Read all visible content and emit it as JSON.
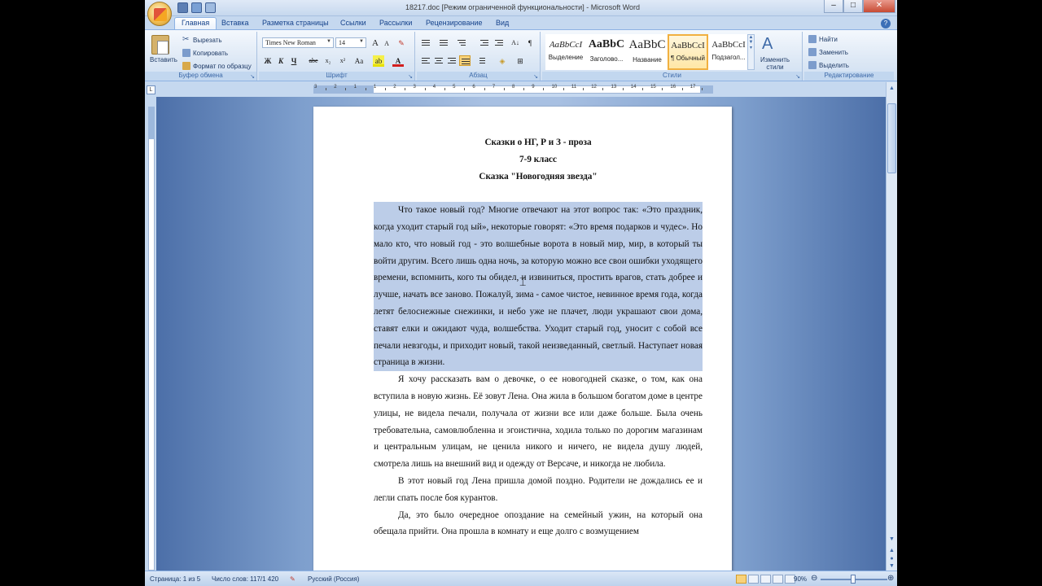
{
  "titlebar": {
    "title": "18217.doc [Режим ограниченной функциональности] - Microsoft Word",
    "controls": [
      "–",
      "□",
      "✕"
    ]
  },
  "tabs": [
    {
      "label": "Главная",
      "active": true
    },
    {
      "label": "Вставка"
    },
    {
      "label": "Разметка страницы"
    },
    {
      "label": "Ссылки"
    },
    {
      "label": "Рассылки"
    },
    {
      "label": "Рецензирование"
    },
    {
      "label": "Вид"
    }
  ],
  "ribbon": {
    "clipboard": {
      "label": "Буфер обмена",
      "paste": "Вставить",
      "cut": "Вырезать",
      "copy": "Копировать",
      "format_painter": "Формат по образцу"
    },
    "font": {
      "label": "Шрифт",
      "font_name": "Times New Roman",
      "font_size": "14",
      "bold": "Ж",
      "italic": "К",
      "underline": "Ч",
      "strike": "abe",
      "subscript": "x₂",
      "superscript": "x²",
      "change_case": "Aa",
      "grow": "A",
      "shrink": "A"
    },
    "paragraph": {
      "label": "Абзац"
    },
    "styles": {
      "label": "Стили",
      "items": [
        {
          "sample": "AaBbCcI",
          "name": "Выделение"
        },
        {
          "sample": "AaBbC",
          "name": "Заголово..."
        },
        {
          "sample": "AaBbC",
          "name": "Название"
        },
        {
          "sample": "AaBbCcI",
          "name": "¶ Обычный",
          "active": true
        },
        {
          "sample": "AaBbCcI",
          "name": "Подзагол..."
        }
      ],
      "change_styles": "Изменить стили"
    },
    "editing": {
      "label": "Редактирование",
      "find": "Найти",
      "replace": "Заменить",
      "select": "Выделить"
    }
  },
  "ruler": {
    "numbers": [
      "3",
      "2",
      "1",
      "1",
      "2",
      "3",
      "4",
      "5",
      "6",
      "7",
      "8",
      "9",
      "10",
      "11",
      "12",
      "13",
      "14",
      "15",
      "16",
      "17"
    ]
  },
  "document": {
    "headings": [
      "Сказки о НГ, Р и З - проза",
      "7-9 класс",
      "Сказка \"Новогодняя звезда\""
    ],
    "paragraphs": [
      {
        "text": "Что такое новый год? Многие отвечают на этот вопрос так: «Это праздник, когда уходит старый год ый», некоторые говорят: «Это время подарков и чудес». Но мало кто, что новый год - это волшебные ворота в новый мир, мир, в который ты войти другим. Всего лишь одна ночь, за которую можно все свои ошибки уходящего времени, вспомнить, кого ты обидел, и  извиниться, простить врагов, стать добрее и лучше, начать все заново. Пожалуй, зима -  самое чистое, невинное время года, когда летят белоснежные снежинки, и небо уже не плачет,  люди  украшают свои дома, ставят елки и ожидают чуда, волшебства. Уходит старый год, уносит с собой все печали невзгоды, и приходит новый, такой неизведанный, светлый. Наступает новая страница в жизни.",
        "selected": true
      },
      {
        "text": "Я хочу рассказать вам о девочке, о ее новогодней сказке, о том, как она вступила в новую жизнь. Её зовут Лена. Она жила в большом богатом доме в центре улицы, не видела печали, получала от жизни все или даже больше. Была очень требовательна, самовлюбленна и эгоистична, ходила только по дорогим магазинам и центральным улицам,  не ценила никого и ничего, не видела душу людей,  смотрела лишь на внешний вид  и одежду от Версаче, и никогда  не любила."
      },
      {
        "text": "В этот новый год Лена пришла домой поздно. Родители не дождались ее и легли спать после боя курантов."
      },
      {
        "text": "Да, это было очередное опоздание на семейный ужин, на который она обещала прийти. Она прошла в комнату и еще долго с возмущением"
      }
    ]
  },
  "statusbar": {
    "page": "Страница: 1 из 5",
    "words": "Число слов: 117/1 420",
    "language": "Русский (Россия)",
    "zoom": "90%",
    "zoom_minus": "⊖",
    "zoom_plus": "⊕"
  }
}
